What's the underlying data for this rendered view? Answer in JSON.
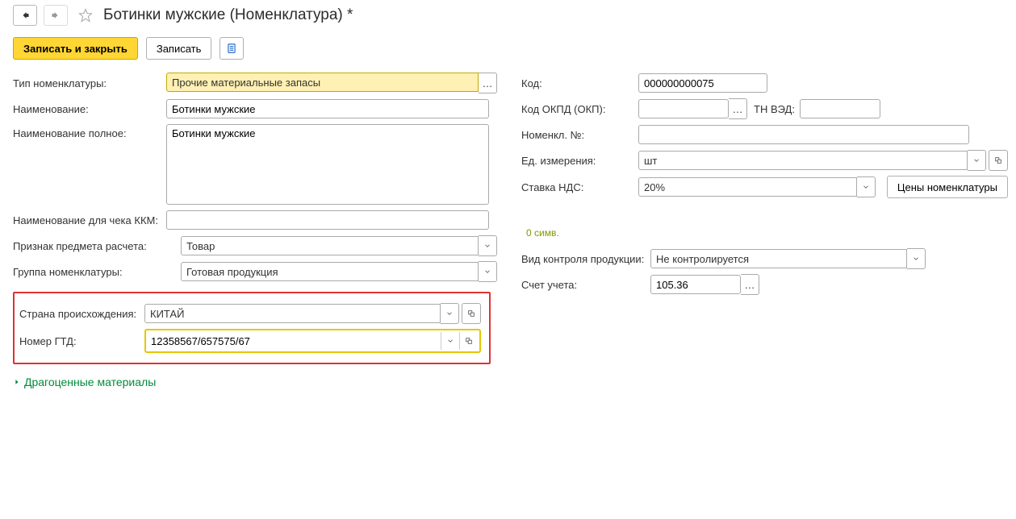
{
  "header": {
    "title": "Ботинки мужские (Номенклатура) *"
  },
  "toolbar": {
    "save_close": "Записать и закрыть",
    "save": "Записать"
  },
  "left": {
    "type_label": "Тип номенклатуры:",
    "type_value": "Прочие материальные запасы",
    "name_label": "Наименование:",
    "name_value": "Ботинки мужские",
    "fullname_label": "Наименование полное:",
    "fullname_value": "Ботинки мужские",
    "kkm_label": "Наименование для чека ККМ:",
    "kkm_value": "",
    "attr_label": "Признак предмета расчета:",
    "attr_value": "Товар",
    "group_label": "Группа номенклатуры:",
    "group_value": "Готовая продукция"
  },
  "right": {
    "code_label": "Код:",
    "code_value": "000000000075",
    "okpd_label": "Код ОКПД (ОКП):",
    "okpd_value": "",
    "tnved_label": "ТН ВЭД:",
    "tnved_value": "",
    "nomnum_label": "Номенкл. №:",
    "nomnum_value": "",
    "unit_label": "Ед. измерения:",
    "unit_value": "шт",
    "vat_label": "Ставка НДС:",
    "vat_value": "20%",
    "prices_btn": "Цены номенклатуры",
    "char_count": "0 симв.",
    "control_label": "Вид контроля продукции:",
    "control_value": "Не контролируется",
    "account_label": "Счет учета:",
    "account_value": "105.36"
  },
  "highlight": {
    "country_label": "Страна происхождения:",
    "country_value": "КИТАЙ",
    "gtd_label": "Номер ГТД:",
    "gtd_value": "12358567/657575/67"
  },
  "section": {
    "precious": "Драгоценные материалы"
  }
}
